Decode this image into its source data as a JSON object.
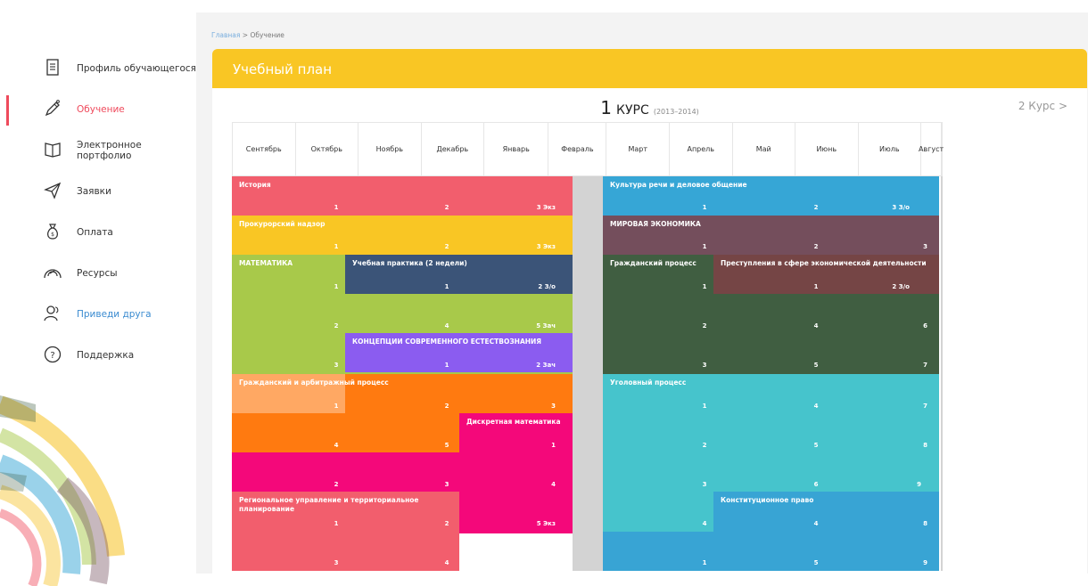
{
  "sidebar": {
    "items": [
      {
        "label": "Профиль обучающегося",
        "icon": "document-icon"
      },
      {
        "label": "Обучение",
        "icon": "pen-icon"
      },
      {
        "label": "Электронное портфолио",
        "icon": "book-icon"
      },
      {
        "label": "Заявки",
        "icon": "send-icon"
      },
      {
        "label": "Оплата",
        "icon": "money-bag-icon"
      },
      {
        "label": "Ресурсы",
        "icon": "resources-icon"
      },
      {
        "label": "Приведи друга",
        "icon": "users-icon"
      },
      {
        "label": "Поддержка",
        "icon": "help-icon"
      }
    ]
  },
  "breadcrumb": {
    "home": "Главная",
    "separator": " > ",
    "current": "Обучение"
  },
  "plan": {
    "title": "Учебный план"
  },
  "course": {
    "number": "1",
    "label": "КУРС",
    "years": "(2013–2014)",
    "next": "2 Курс >"
  },
  "months": [
    "Сентябрь",
    "Октябрь",
    "Ноябрь",
    "Декабрь",
    "Январь",
    "Февраль",
    "Март",
    "Апрель",
    "Май",
    "Июнь",
    "Июль",
    "Август"
  ],
  "blocks": [
    {
      "title": "История",
      "color": "#f25e6d",
      "counts": [
        "1",
        "2",
        "3 Экз"
      ]
    },
    {
      "title": "Прокурорский надзор",
      "color": "#f9c624",
      "counts": [
        "1",
        "2",
        "3 Экз"
      ]
    },
    {
      "title": "МАТЕМАТИКА",
      "color": "#a8c94a",
      "counts": [
        "1",
        "2",
        "3",
        "4",
        "5 Зач"
      ]
    },
    {
      "title": "Учебная практика (2 недели)",
      "color": "#3b5478",
      "counts": [
        "1",
        "2 З/о"
      ]
    },
    {
      "title": "КОНЦЕПЦИИ СОВРЕМЕННОГО ЕСТЕСТВОЗНАНИЯ",
      "color": "#8b5cf0",
      "counts": [
        "1",
        "2 Зач"
      ]
    },
    {
      "title": "Гражданский и арбитражный процесс",
      "color": "#ff7a10",
      "counts": [
        "1",
        "2",
        "3",
        "4",
        "5"
      ]
    },
    {
      "title": "Дискретная математика",
      "color": "#f4087a",
      "counts": [
        "1",
        "2",
        "3",
        "4"
      ]
    },
    {
      "title": "Региональное управление и территориальное планирование",
      "color": "#f25e6d",
      "counts": [
        "1",
        "2",
        "3",
        "4",
        "5",
        "5 Экз"
      ]
    },
    {
      "title": "Культура речи и деловое общение",
      "color": "#36a6d6",
      "counts": [
        "1",
        "2",
        "3 З/о"
      ]
    },
    {
      "title": "МИРОВАЯ ЭКОНОМИКА",
      "color": "#744e5c",
      "counts": [
        "1",
        "2",
        "3"
      ]
    },
    {
      "title": "Гражданский процесс",
      "color": "#405e41",
      "counts": [
        "1",
        "2",
        "3",
        "4",
        "5",
        "6",
        "7"
      ]
    },
    {
      "title": "Преступления в сфере экономической деятельности",
      "color": "#754545",
      "counts": [
        "1",
        "2 З/о"
      ]
    },
    {
      "title": "Уголовный процесс",
      "color": "#46c4cc",
      "counts": [
        "1",
        "2",
        "3",
        "4",
        "5",
        "6",
        "7",
        "8",
        "9",
        "10"
      ]
    },
    {
      "title": "Конституционное право",
      "color": "#38a4d4",
      "counts": [
        "4",
        "4",
        "8",
        "1",
        "5",
        "9"
      ]
    }
  ]
}
